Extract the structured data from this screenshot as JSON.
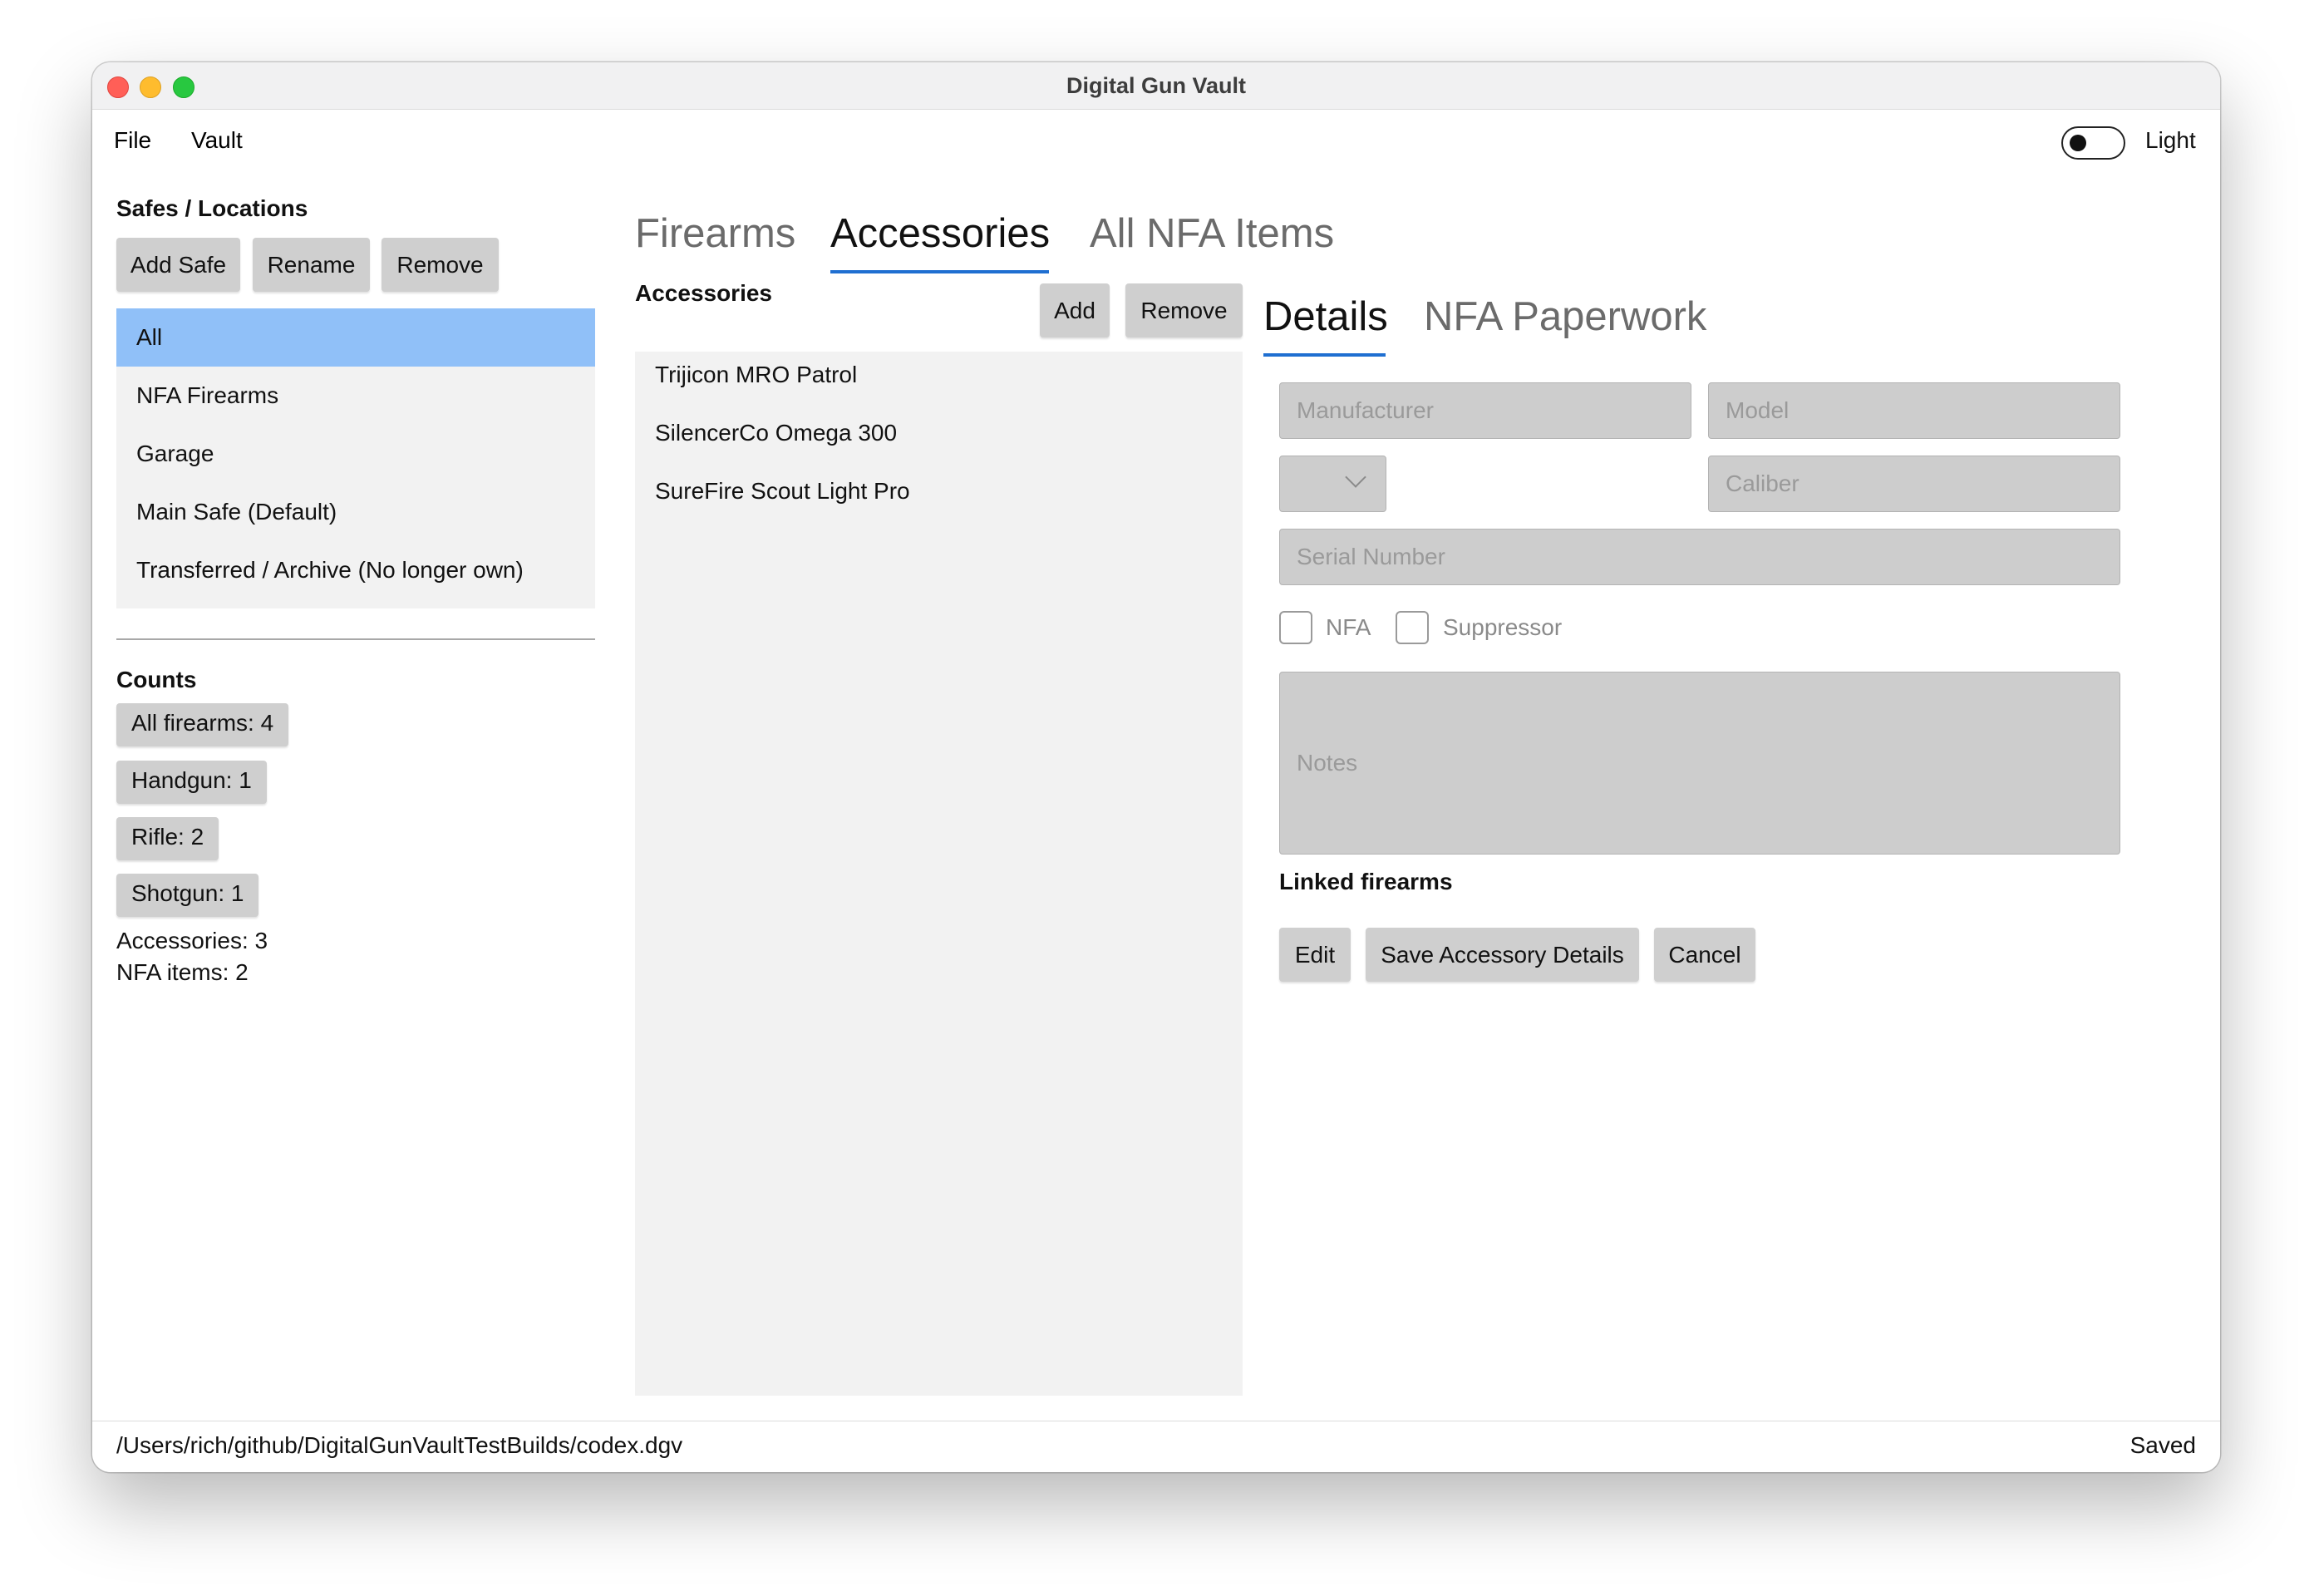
{
  "window": {
    "title": "Digital Gun Vault"
  },
  "menu": {
    "file": "File",
    "vault": "Vault"
  },
  "theme_toggle": {
    "label": "Light",
    "on": false
  },
  "safes": {
    "title": "Safes / Locations",
    "buttons": {
      "add": "Add Safe",
      "rename": "Rename",
      "remove": "Remove"
    },
    "items": [
      {
        "label": "All",
        "selected": true
      },
      {
        "label": "NFA Firearms"
      },
      {
        "label": "Garage"
      },
      {
        "label": "Main Safe (Default)"
      },
      {
        "label": "Transferred / Archive (No longer own)"
      }
    ]
  },
  "counts": {
    "title": "Counts",
    "chips": [
      "All firearms: 4",
      "Handgun: 1",
      "Rifle: 2",
      "Shotgun: 1"
    ],
    "accessories": "Accessories: 3",
    "nfa_items": "NFA items: 2"
  },
  "main_tabs": [
    {
      "label": "Firearms"
    },
    {
      "label": "Accessories",
      "active": true
    },
    {
      "label": "All NFA Items"
    }
  ],
  "accessories": {
    "title": "Accessories",
    "add_label": "Add",
    "remove_label": "Remove",
    "items": [
      "Trijicon MRO Patrol",
      "SilencerCo Omega 300",
      "SureFire Scout Light Pro"
    ]
  },
  "detail_tabs": [
    {
      "label": "Details",
      "active": true
    },
    {
      "label": "NFA Paperwork"
    }
  ],
  "form": {
    "manufacturer_placeholder": "Manufacturer",
    "model_placeholder": "Model",
    "caliber_placeholder": "Caliber",
    "serial_placeholder": "Serial Number",
    "notes_placeholder": "Notes",
    "nfa_label": "NFA",
    "suppressor_label": "Suppressor",
    "linked_firearms_label": "Linked firearms",
    "edit_label": "Edit",
    "save_label": "Save Accessory Details",
    "cancel_label": "Cancel"
  },
  "status": {
    "path": "/Users/rich/github/DigitalGunVaultTestBuilds/codex.dgv",
    "state": "Saved"
  },
  "colors": {
    "selected_row": "#90c0f8",
    "tab_underline": "#1f6fd1",
    "button_bg": "#cfcfcf",
    "field_bg": "#cdcdcd",
    "panel_bg": "#f2f2f2"
  }
}
